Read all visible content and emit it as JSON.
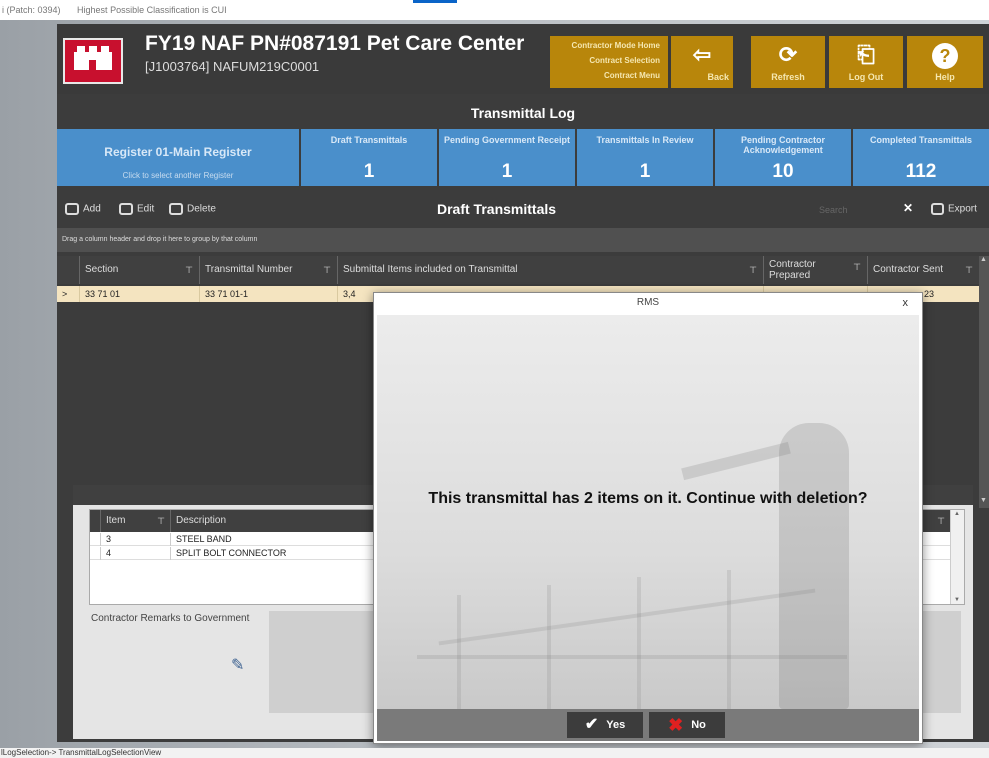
{
  "topbar": {
    "patch": "i (Patch: 0394)",
    "classification": "Highest Possible Classification is CUI"
  },
  "header": {
    "title": "FY19 NAF PN#087191 Pet Care Center",
    "subtitle": "[J1003764] NAFUM219C0001",
    "menu_items": [
      "Contractor Mode Home",
      "Contract Selection",
      "Contract Menu"
    ],
    "buttons": {
      "back": "Back",
      "refresh": "Refresh",
      "logout": "Log Out",
      "help": "Help"
    }
  },
  "section_title": "Transmittal Log",
  "register": {
    "title": "Register 01-Main Register",
    "hint": "Click to select another Register"
  },
  "tiles": [
    {
      "label": "Draft Transmittals",
      "value": "1"
    },
    {
      "label": "Pending Government Receipt",
      "value": "1"
    },
    {
      "label": "Transmittals In Review",
      "value": "1"
    },
    {
      "label": "Pending Contractor Acknowledgement",
      "value": "10"
    },
    {
      "label": "Completed Transmittals",
      "value": "112"
    }
  ],
  "toolbar": {
    "add": "Add",
    "edit": "Edit",
    "delete": "Delete",
    "title": "Draft Transmittals",
    "search_placeholder": "Search",
    "export": "Export"
  },
  "group_hint": "Drag a column header and drop it here to group by that column",
  "grid": {
    "columns": [
      "Section",
      "Transmittal Number",
      "Submittal Items included on Transmittal",
      "Contractor Prepared",
      "Contractor Sent"
    ],
    "rows": [
      {
        "indicator": ">",
        "section": "33 71 01",
        "transmittal_number": "33 71 01-1",
        "items": "3,4",
        "prepared": "",
        "sent": "23"
      }
    ]
  },
  "items_grid": {
    "columns": [
      "Item",
      "Description"
    ],
    "rows": [
      {
        "item": "3",
        "description": "STEEL BAND"
      },
      {
        "item": "4",
        "description": "SPLIT BOLT CONNECTOR"
      }
    ]
  },
  "remarks_label": "Contractor Remarks to Government",
  "dialog": {
    "title": "RMS",
    "close": "x",
    "message": "This transmittal has 2 items on it. Continue with deletion?",
    "yes": "Yes",
    "no": "No"
  },
  "statusbar": "lLogSelection-> TransmittalLogSelectionView",
  "colors": {
    "app_bg": "#3c3c3c",
    "tile_blue": "#4a8fcb",
    "gold": "#b8860b",
    "logo_red": "#c8102e",
    "row_highlight": "#f4e4c0"
  }
}
